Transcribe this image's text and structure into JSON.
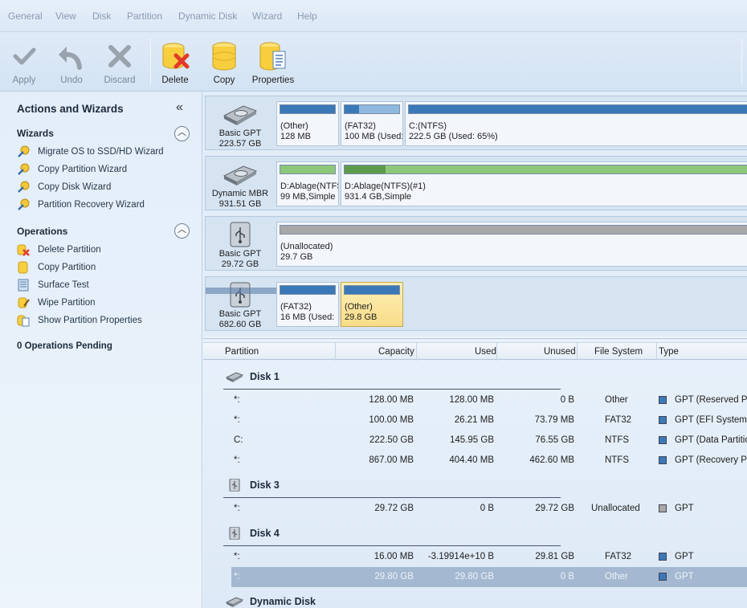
{
  "menu": [
    "General",
    "View",
    "Disk",
    "Partition",
    "Dynamic Disk",
    "Wizard",
    "Help"
  ],
  "toolbar": {
    "apply": "Apply",
    "undo": "Undo",
    "discard": "Discard",
    "delete": "Delete",
    "copy": "Copy",
    "properties": "Properties"
  },
  "left_panel": {
    "title": "Actions and Wizards",
    "wizards_title": "Wizards",
    "wizards": [
      {
        "label": "Migrate OS to SSD/HD Wizard"
      },
      {
        "label": "Copy Partition Wizard"
      },
      {
        "label": "Copy Disk Wizard"
      },
      {
        "label": "Partition Recovery Wizard"
      }
    ],
    "operations_title": "Operations",
    "operations": [
      {
        "label": "Delete Partition"
      },
      {
        "label": "Copy Partition"
      },
      {
        "label": "Surface Test"
      },
      {
        "label": "Wipe Partition"
      },
      {
        "label": "Show Partition Properties"
      }
    ],
    "pending": "0 Operations Pending"
  },
  "disk_map": [
    {
      "type": "Basic GPT",
      "size": "223.57 GB",
      "icon": "hard-disk-icon",
      "partitions": [
        {
          "name": "(Other)",
          "size": "128 MB",
          "used_fraction": 1.0,
          "color": "#3a78b8"
        },
        {
          "name": "(FAT32)",
          "size": "100 MB (Used:",
          "used_fraction": 0.26,
          "color": "#3a78b8"
        },
        {
          "name": "C:(NTFS)",
          "size": "222.5 GB (Used: 65%)",
          "used_fraction": 0.65,
          "color": "#3a78b8"
        }
      ]
    },
    {
      "type": "Dynamic MBR",
      "size": "931.51 GB",
      "icon": "hard-disk-icon",
      "partitions": [
        {
          "name": "D:Ablage(NTFS",
          "size": "99 MB,Simple",
          "used_fraction": 0.0,
          "color": "#8cc77a"
        },
        {
          "name": "D:Ablage(NTFS)(#1)",
          "size": "931.4 GB,Simple",
          "used_fraction": 0.1,
          "color": "#8cc77a"
        }
      ]
    },
    {
      "type": "Basic GPT",
      "size": "29.72 GB",
      "icon": "usb-disk-icon",
      "partitions": [
        {
          "name": "(Unallocated)",
          "size": "29.7 GB",
          "used_fraction": 0.0,
          "color": "#a7a7a7"
        }
      ]
    },
    {
      "type": "Basic GPT",
      "size": "682.60 GB",
      "icon": "usb-disk-icon",
      "partitions": [
        {
          "name": "(FAT32)",
          "size": "16 MB (Used: ",
          "used_fraction": 1.0,
          "color": "#3a78b8"
        },
        {
          "name": "(Other)",
          "size": "29.8 GB",
          "used_fraction": 1.0,
          "color": "#3a78b8",
          "selected": true
        }
      ]
    }
  ],
  "table": {
    "headers": [
      "Partition",
      "Capacity",
      "Used",
      "Unused",
      "File System",
      "Type"
    ],
    "groups": [
      {
        "name": "Disk 1",
        "icon": "hard-disk-icon",
        "rows": [
          {
            "partition": "*:",
            "capacity": "128.00 MB",
            "used": "128.00 MB",
            "unused": "0 B",
            "fs": "Other",
            "type": "GPT (Reserved Pa",
            "swatch": "#3a78b8"
          },
          {
            "partition": "*:",
            "capacity": "100.00 MB",
            "used": "26.21 MB",
            "unused": "73.79 MB",
            "fs": "FAT32",
            "type": "GPT (EFI System p",
            "swatch": "#3a78b8"
          },
          {
            "partition": "C:",
            "capacity": "222.50 GB",
            "used": "145.95 GB",
            "unused": "76.55 GB",
            "fs": "NTFS",
            "type": "GPT (Data Partitio",
            "swatch": "#3a78b8"
          },
          {
            "partition": "*:",
            "capacity": "867.00 MB",
            "used": "404.40 MB",
            "unused": "462.60 MB",
            "fs": "NTFS",
            "type": "GPT (Recovery Pa",
            "swatch": "#3a78b8"
          }
        ]
      },
      {
        "name": "Disk 3",
        "icon": "usb-disk-icon",
        "rows": [
          {
            "partition": "*:",
            "capacity": "29.72 GB",
            "used": "0 B",
            "unused": "29.72 GB",
            "fs": "Unallocated",
            "type": "GPT",
            "swatch": "#a7a7a7"
          }
        ]
      },
      {
        "name": "Disk 4",
        "icon": "usb-disk-icon",
        "rows": [
          {
            "partition": "*:",
            "capacity": "16.00 MB",
            "used": "-3.19914e+10 B",
            "unused": "29.81 GB",
            "fs": "FAT32",
            "type": "GPT",
            "swatch": "#3a78b8"
          },
          {
            "partition": "*:",
            "capacity": "29.80 GB",
            "used": "29.80 GB",
            "unused": "0 B",
            "fs": "Other",
            "type": "GPT",
            "swatch": "#3a78b8",
            "selected": true
          }
        ]
      },
      {
        "name": "Dynamic Disk",
        "icon": "hard-disk-icon",
        "rows": []
      }
    ]
  }
}
